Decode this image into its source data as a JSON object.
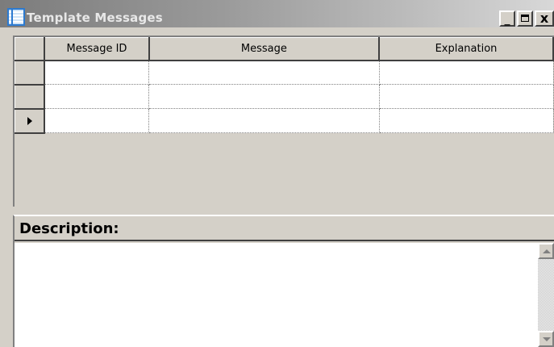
{
  "window": {
    "title": "Template Messages",
    "buttons": {
      "minimize": "_",
      "close": "x"
    }
  },
  "grid": {
    "columns": [
      "Message ID",
      "Message",
      "Explanation"
    ],
    "rows": [
      {
        "message_id": "",
        "message": "",
        "explanation": "",
        "current": false
      },
      {
        "message_id": "",
        "message": "",
        "explanation": "",
        "current": false
      },
      {
        "message_id": "",
        "message": "",
        "explanation": "",
        "current": true
      }
    ]
  },
  "description": {
    "label": "Description:",
    "text": ""
  },
  "colors": {
    "face": "#d4d0c8",
    "cell_background": "#ffffff",
    "titlebar_gradient_start": "#7c7c7c",
    "titlebar_gradient_end": "#d8d8d8"
  },
  "icons": [
    "app-grid-icon",
    "minimize-icon",
    "maximize-icon",
    "close-icon",
    "current-row-arrow-icon",
    "scroll-up-icon",
    "scroll-down-icon"
  ]
}
